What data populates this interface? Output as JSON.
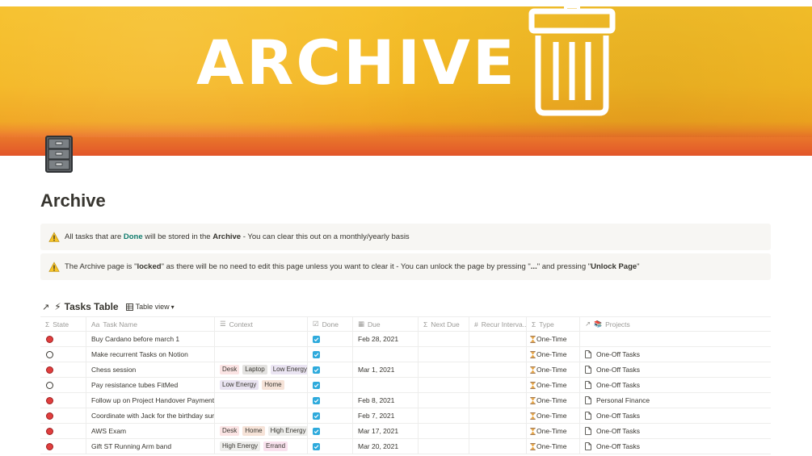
{
  "banner": {
    "title": "ARCHIVE"
  },
  "page": {
    "title": "Archive"
  },
  "callouts": [
    {
      "pre": "All tasks that are ",
      "em": "Done",
      "mid": " will be stored in the ",
      "strong": "Archive",
      "post": " - You can clear this out on a monthly/yearly basis"
    },
    {
      "pre": "The Archive page is \"",
      "strong1": "locked",
      "mid": "\" as there will be no need to edit this page unless you want to clear it - You can unlock the page by pressing \"",
      "strong2": "...",
      "mid2": "\" and pressing \"",
      "strong3": "Unlock Page",
      "post": "\""
    }
  ],
  "table": {
    "title": "Tasks Table",
    "view_label": "Table view",
    "columns": [
      {
        "label": "State",
        "icon": "sigma-icon"
      },
      {
        "label": "Task Name",
        "icon": "title-icon"
      },
      {
        "label": "Context",
        "icon": "list-icon"
      },
      {
        "label": "Done",
        "icon": "checkbox-icon"
      },
      {
        "label": "Due",
        "icon": "calendar-icon"
      },
      {
        "label": "Next Due",
        "icon": "sigma-icon"
      },
      {
        "label": "Recur Interva...",
        "icon": "hash-icon"
      },
      {
        "label": "Type",
        "icon": "sigma-icon"
      },
      {
        "label": "Projects",
        "icon": "relation-icon"
      }
    ],
    "rows": [
      {
        "state": "red",
        "name": "Buy Cardano before march 1",
        "context": [],
        "done": true,
        "due": "Feb 28, 2021",
        "type": "One-Time",
        "project": ""
      },
      {
        "state": "empty",
        "name": "Make recurrent Tasks on Notion",
        "context": [],
        "done": true,
        "due": "",
        "type": "One-Time",
        "project": "One-Off Tasks"
      },
      {
        "state": "red",
        "name": "Chess session",
        "context": [
          "Desk",
          "Laptop",
          "Low Energy"
        ],
        "done": true,
        "due": "Mar 1, 2021",
        "type": "One-Time",
        "project": "One-Off Tasks"
      },
      {
        "state": "empty",
        "name": "Pay resistance tubes FitMed",
        "context": [
          "Low Energy",
          "Home"
        ],
        "done": true,
        "due": "",
        "type": "One-Time",
        "project": "One-Off Tasks"
      },
      {
        "state": "red",
        "name": "Follow up on Project Handover Payment",
        "context": [],
        "done": true,
        "due": "Feb 8, 2021",
        "type": "One-Time",
        "project": "Personal Finance"
      },
      {
        "state": "red",
        "name": "Coordinate with Jack for the birthday surpr",
        "context": [],
        "done": true,
        "due": "Feb 7, 2021",
        "type": "One-Time",
        "project": "One-Off Tasks"
      },
      {
        "state": "red",
        "name": "AWS Exam",
        "context": [
          "Desk",
          "Home",
          "High Energy"
        ],
        "done": true,
        "due": "Mar 17, 2021",
        "type": "One-Time",
        "project": "One-Off Tasks"
      },
      {
        "state": "red",
        "name": "Gift ST Running Arm band",
        "context": [
          "High Energy",
          "Errand"
        ],
        "done": true,
        "due": "Mar 20, 2021",
        "type": "One-Time",
        "project": "One-Off Tasks"
      }
    ]
  },
  "tag_colors": {
    "Desk": "#fbe4e4",
    "Laptop": "#e3e2e0",
    "Low Energy": "#eae4f2",
    "Home": "#f6e3d8",
    "High Energy": "#eeeeec",
    "Errand": "#f9e2ee"
  },
  "colors": {
    "done_check": "#2eaadc",
    "state_red": "#e03e3e",
    "banner_yellow": "#f4b723"
  }
}
